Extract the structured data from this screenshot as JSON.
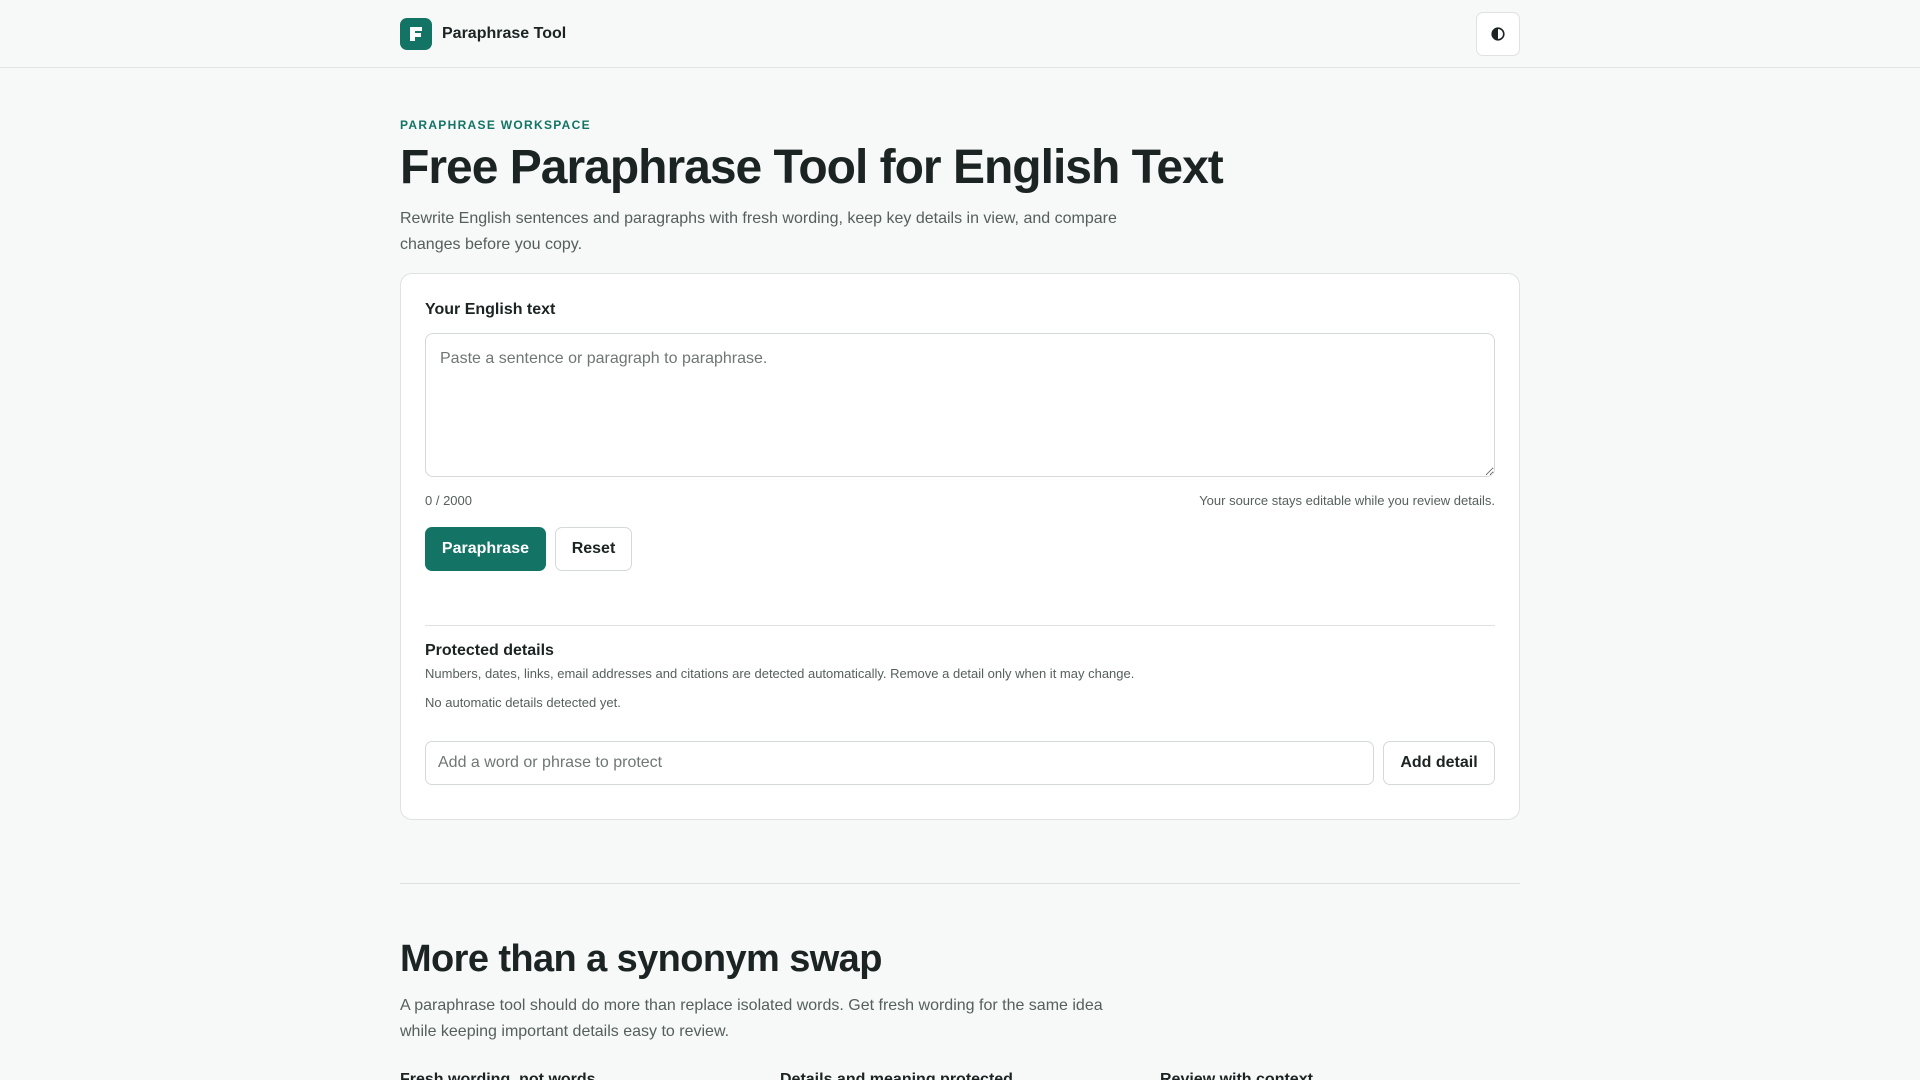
{
  "header": {
    "logo_letter": "F",
    "brand": "Paraphrase Tool",
    "theme_toggle_icon": "half-circle-contrast-icon",
    "accent_color": "#137465"
  },
  "hero": {
    "eyebrow": "PARAPHRASE WORKSPACE",
    "title": "Free Paraphrase Tool for English Text",
    "lead": "Rewrite English sentences and paragraphs with fresh wording, keep key details in view, and compare changes before you copy."
  },
  "editor": {
    "label": "Your English text",
    "placeholder": "Paste a sentence or paragraph to paraphrase.",
    "value": "",
    "counter": "0 / 2000",
    "hint": "Your source stays editable while you review details.",
    "paraphrase_label": "Paraphrase",
    "reset_label": "Reset"
  },
  "protected": {
    "title": "Protected details",
    "description": "Numbers, dates, links, email addresses and citations are detected automatically. Remove a detail only when it may change.",
    "empty": "No automatic details detected yet.",
    "input_placeholder": "Add a word or phrase to protect",
    "add_label": "Add detail"
  },
  "more": {
    "title": "More than a synonym swap",
    "lead": "A paraphrase tool should do more than replace isolated words. Get fresh wording for the same idea while keeping important details easy to review.",
    "features": [
      {
        "label": "Fresh wording, not words"
      },
      {
        "label": "Details and meaning protected"
      },
      {
        "label": "Review with context"
      }
    ]
  }
}
